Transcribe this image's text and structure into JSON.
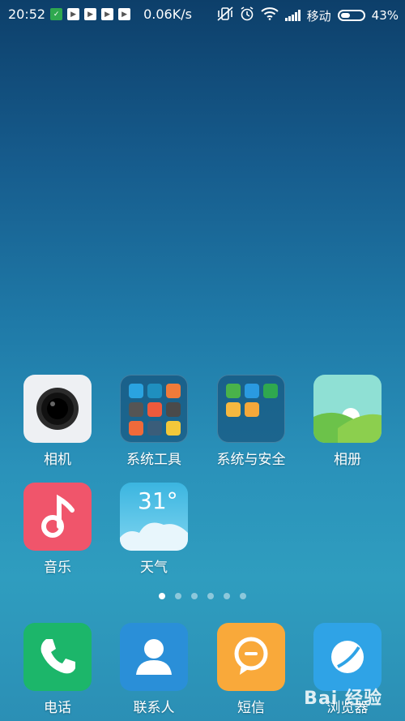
{
  "status_bar": {
    "time": "20:52",
    "net_speed": "0.06K/s",
    "carrier": "移动",
    "battery_percent": "43%",
    "battery_level": 0.43
  },
  "apps": [
    {
      "label": "相机"
    },
    {
      "label": "系统工具"
    },
    {
      "label": "系统与安全"
    },
    {
      "label": "相册"
    },
    {
      "label": "音乐"
    },
    {
      "label": "天气",
      "temperature": "31°"
    }
  ],
  "dock": [
    {
      "label": "电话"
    },
    {
      "label": "联系人"
    },
    {
      "label": "短信"
    },
    {
      "label": "浏览器"
    }
  ],
  "page_indicator": {
    "count": 6,
    "active": 1
  },
  "watermark": "Bai 经验",
  "colors": {
    "camera_bg": "#eef0f3",
    "music_bg": "#f0556b",
    "phone_bg": "#1cb66a",
    "contacts_bg": "#2a8fd8",
    "sms_bg": "#f9a93a",
    "browser_bg": "#2fa3e6"
  }
}
